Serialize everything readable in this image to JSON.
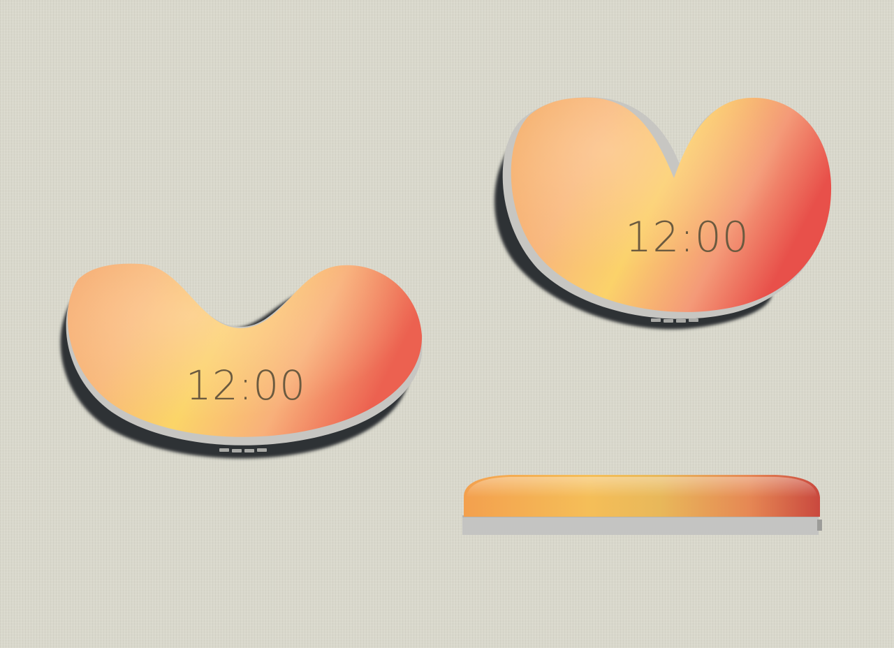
{
  "scene": {
    "background_color": "#d9d8cc",
    "objects": [
      {
        "name": "clock-left-angled-view",
        "display_text": "12:00"
      },
      {
        "name": "clock-right-angled-view",
        "display_text": "12:00"
      },
      {
        "name": "clock-side-view"
      }
    ],
    "colors": {
      "body_orange": "#f4a25c",
      "body_yellow": "#fbd56a",
      "body_peach": "#f7b58a",
      "body_red": "#e8584e",
      "base_gray": "#c4c4c2",
      "shadow": "#2f3036",
      "text": "#6b5a3f"
    }
  }
}
